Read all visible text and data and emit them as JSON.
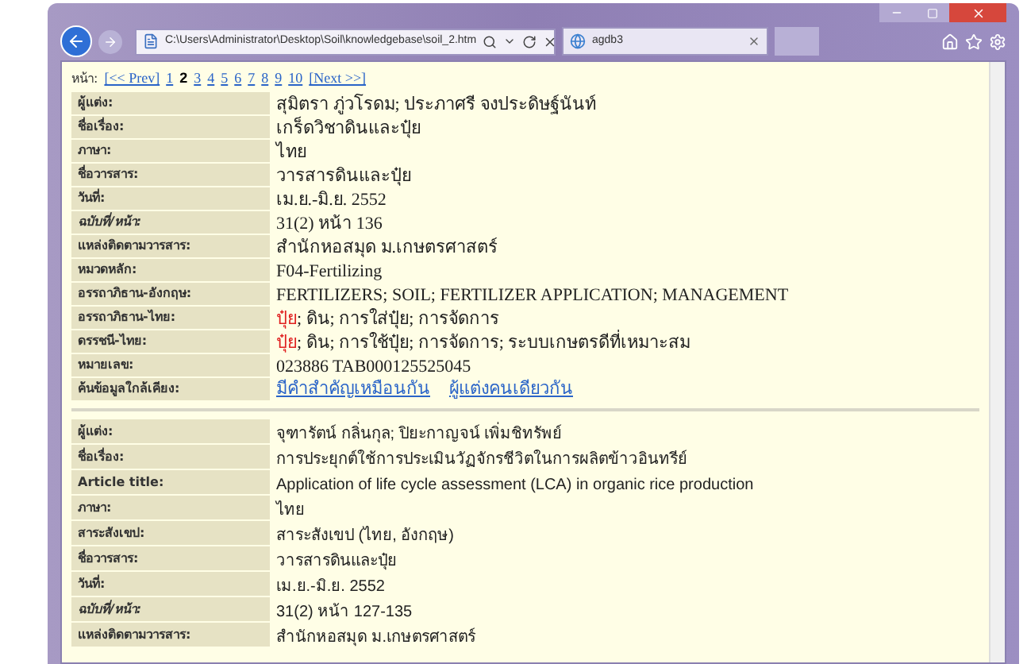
{
  "browser": {
    "address": "C:\\Users\\Administrator\\Desktop\\Soil\\knowledgebase\\soil_2.htm",
    "tab": {
      "title": "agdb3"
    }
  },
  "pager": {
    "label": "หน้า:",
    "prev": "[<< Prev]",
    "pages": [
      {
        "text": "1",
        "selected": false
      },
      {
        "text": "2",
        "selected": true
      },
      {
        "text": "3",
        "selected": false
      },
      {
        "text": "4",
        "selected": false
      },
      {
        "text": "5",
        "selected": false
      },
      {
        "text": "6",
        "selected": false
      },
      {
        "text": "7",
        "selected": false
      },
      {
        "text": "8",
        "selected": false
      },
      {
        "text": "9",
        "selected": false
      },
      {
        "text": "10",
        "selected": false
      }
    ],
    "next": "[Next >>]"
  },
  "records": [
    {
      "kind": "serif",
      "fields": [
        {
          "label": "ผู้แต่ง:",
          "value": "สุมิตรา ภู่วโรดม; ประภาศรี จงประดิษฐ์นันท์"
        },
        {
          "label": "ชื่อเรื่อง:",
          "value": "เกร็ดวิชาดินและปุ๋ย"
        },
        {
          "label": "ภาษา:",
          "value": "ไทย"
        },
        {
          "label": "ชื่อวารสาร:",
          "value": "วารสารดินและปุ๋ย"
        },
        {
          "label": "วันที่:",
          "value": "เม.ย.-มิ.ย. 2552"
        },
        {
          "label": "ฉบับที่/หน้า:",
          "italic": true,
          "value": "31(2) หน้า 136"
        },
        {
          "label": "แหล่งติดตามวารสาร:",
          "value": "สำนักหอสมุด ม.เกษตรศาสตร์"
        },
        {
          "label": "หมวดหลัก:",
          "value": "F04-Fertilizing"
        },
        {
          "label": "อรรถาภิธาน-อังกฤษ:",
          "value": "FERTILIZERS; SOIL; FERTILIZER APPLICATION; MANAGEMENT"
        },
        {
          "label": "อรรถาภิธาน-ไทย:",
          "parts": [
            {
              "text": "ปุ๋ย",
              "highlighted": true
            },
            {
              "text": "; ดิน; การใส่ปุ๋ย; การจัดการ",
              "highlighted": false
            }
          ]
        },
        {
          "label": "ดรรชนี-ไทย:",
          "parts": [
            {
              "text": "ปุ๋ย",
              "highlighted": true
            },
            {
              "text": "; ดิน; การใช้ปุ๋ย; การจัดการ; ระบบเกษตรดีที่เหมาะสม",
              "highlighted": false
            }
          ]
        },
        {
          "label": "หมายเลข:",
          "value": "023886 TAB000125525045"
        },
        {
          "label": "ค้นข้อมูลใกล้เคียง:",
          "links": [
            "มีคำสำคัญเหมือนกัน",
            "ผู้แต่งคนเดียวกัน"
          ]
        }
      ]
    },
    {
      "kind": "sans",
      "fields": [
        {
          "label": "ผู้แต่ง:",
          "value": "จุฑารัตน์  กลิ่นกุล; ปิยะกาญจน์  เพิ่มชิทรัพย์"
        },
        {
          "label": "ชื่อเรื่อง:",
          "value": "การประยุกต์ใช้การประเมินวัฏจักรชีวิตในการผลิตข้าวอินทรีย์"
        },
        {
          "label": "Article title:",
          "value": "Application of life cycle assessment (LCA) in organic rice production"
        },
        {
          "label": "ภาษา:",
          "value": "ไทย"
        },
        {
          "label": "สาระสังเขป:",
          "value": "สาระสังเขป  (ไทย, อังกฤษ)"
        },
        {
          "label": "ชื่อวารสาร:",
          "value": "วารสารดินและปุ๋ย"
        },
        {
          "label": "วันที่:",
          "value": "เม.ย.-มิ.ย. 2552"
        },
        {
          "label": "ฉบับที่/หน้า:",
          "italic": true,
          "value": "31(2) หน้า  127-135"
        },
        {
          "label": "แหล่งติดตามวารสาร:",
          "value": "สำนักหอสมุด  ม.เกษตรศาสตร์"
        }
      ]
    }
  ]
}
